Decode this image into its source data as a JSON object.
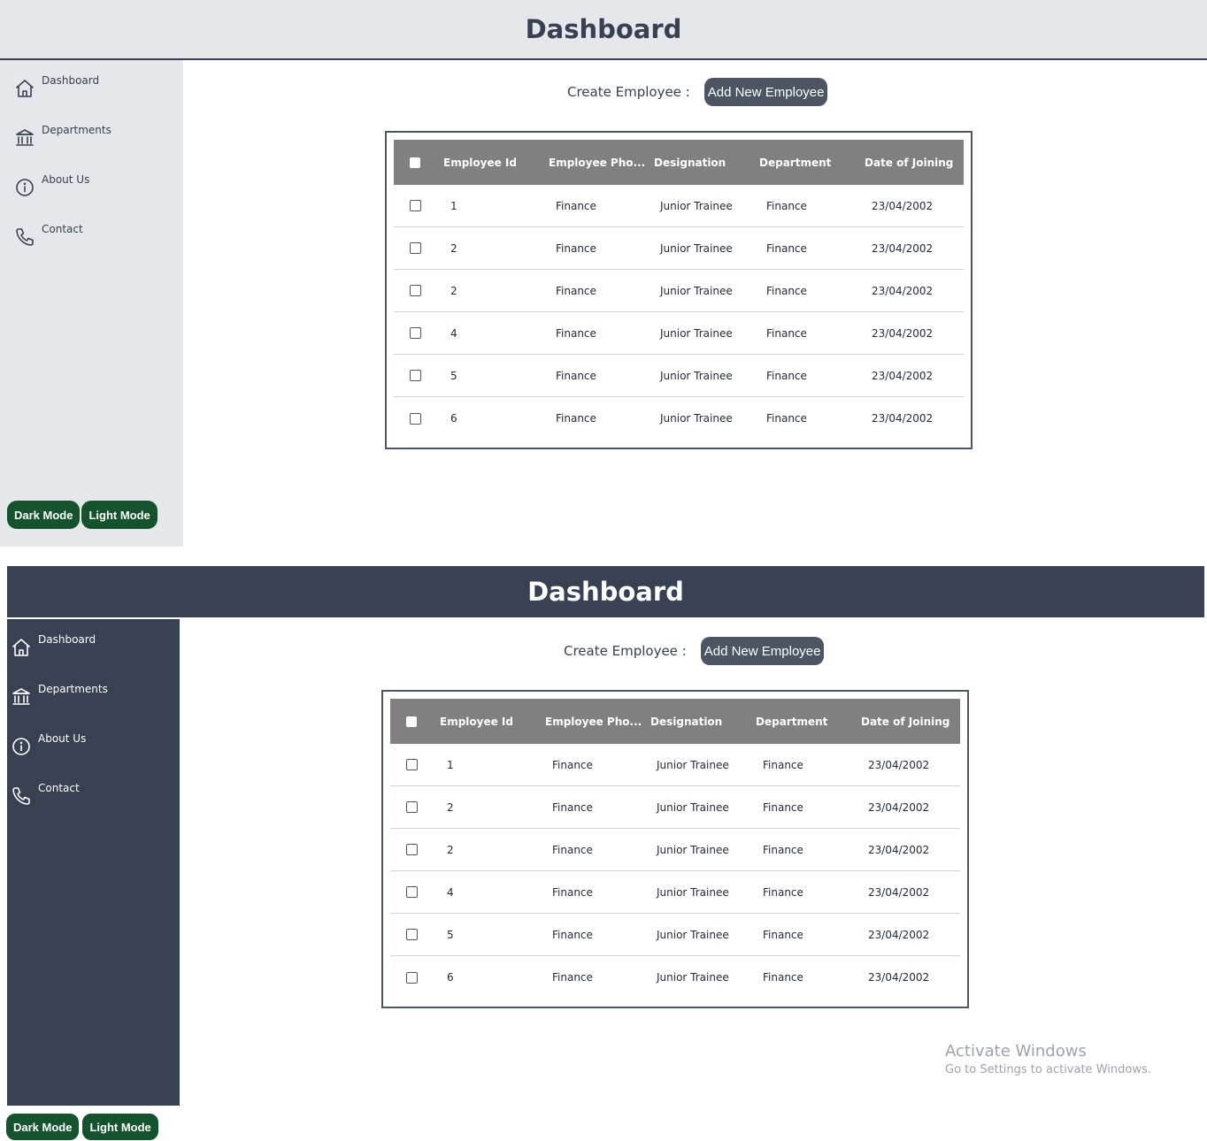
{
  "title": "Dashboard",
  "nav": [
    {
      "label": "Dashboard",
      "icon": "home-icon"
    },
    {
      "label": "Departments",
      "icon": "bank-icon"
    },
    {
      "label": "About Us",
      "icon": "info-icon"
    },
    {
      "label": "Contact",
      "icon": "phone-icon"
    }
  ],
  "mode_buttons": {
    "dark": "Dark Mode",
    "light": "Light Mode"
  },
  "create": {
    "label": "Create Employee :",
    "button": "Add New Employee"
  },
  "table": {
    "headers": [
      "Employee Id",
      "Employee Pho...",
      "Designation",
      "Department",
      "Date of Joining"
    ],
    "rows": [
      [
        "1",
        "Finance",
        "Junior Trainee",
        "Finance",
        "23/04/2002"
      ],
      [
        "2",
        "Finance",
        "Junior Trainee",
        "Finance",
        "23/04/2002"
      ],
      [
        "2",
        "Finance",
        "Junior Trainee",
        "Finance",
        "23/04/2002"
      ],
      [
        "4",
        "Finance",
        "Junior Trainee",
        "Finance",
        "23/04/2002"
      ],
      [
        "5",
        "Finance",
        "Junior Trainee",
        "Finance",
        "23/04/2002"
      ],
      [
        "6",
        "Finance",
        "Junior Trainee",
        "Finance",
        "23/04/2002"
      ]
    ]
  },
  "watermark": {
    "title": "Activate Windows",
    "subtitle": "Go to Settings to activate Windows."
  },
  "colors": {
    "light_header": "#e5e7eb",
    "dark_header": "#374151",
    "table_header": "#808080",
    "mode_button": "#14532d",
    "add_button": "#4b5563"
  }
}
